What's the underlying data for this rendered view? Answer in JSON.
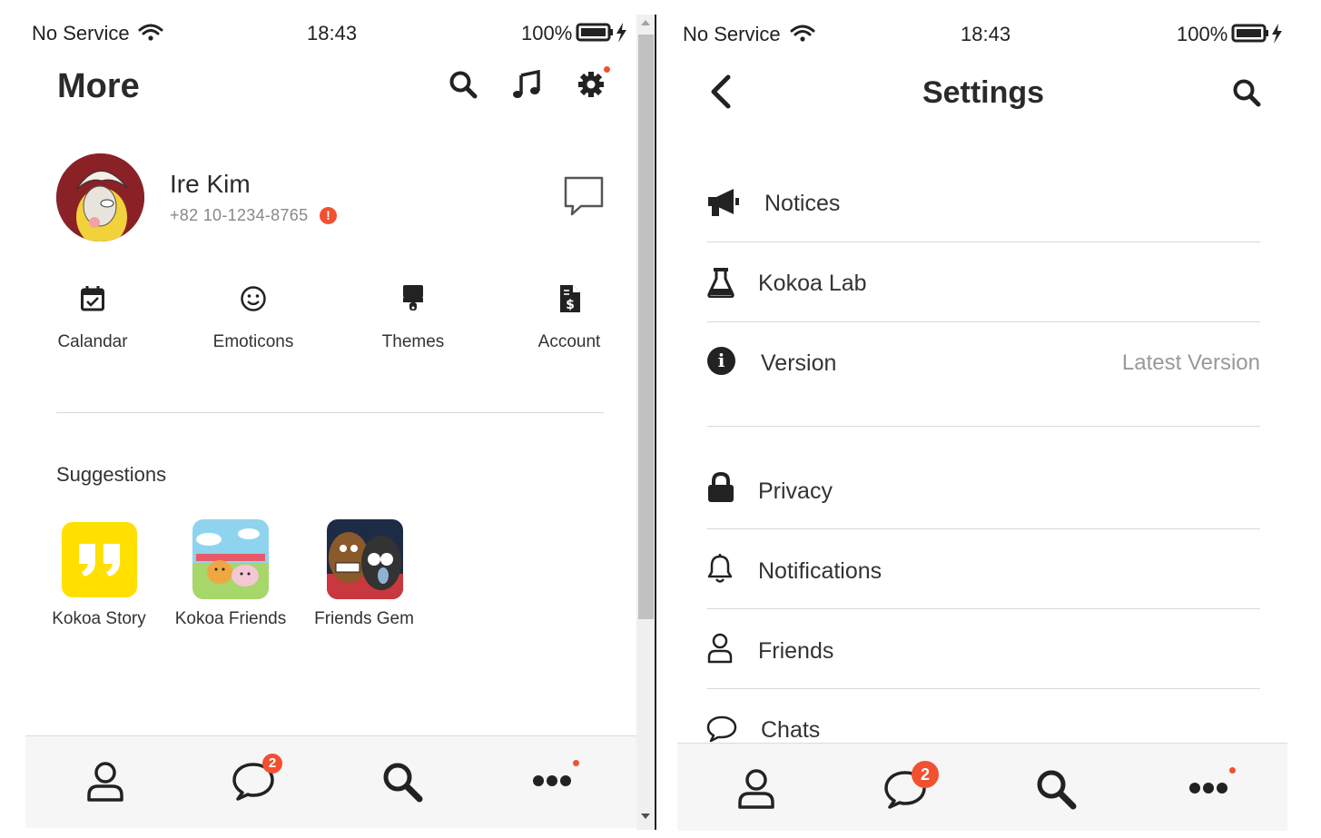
{
  "left": {
    "status": {
      "carrier": "No Service",
      "time": "18:43",
      "battery": "100%"
    },
    "header": {
      "title": "More"
    },
    "profile": {
      "name": "Ire Kim",
      "phone": "+82 10-1234-8765"
    },
    "quick_actions": [
      {
        "label": "Calandar",
        "icon": "calendar-check-icon"
      },
      {
        "label": "Emoticons",
        "icon": "smiley-icon"
      },
      {
        "label": "Themes",
        "icon": "paint-brush-icon"
      },
      {
        "label": "Account",
        "icon": "invoice-icon"
      }
    ],
    "suggestions": {
      "title": "Suggestions",
      "items": [
        {
          "label": "Kokoa Story"
        },
        {
          "label": "Kokoa Friends"
        },
        {
          "label": "Friends Gem"
        }
      ]
    },
    "tabbar": {
      "chat_badge": "2"
    }
  },
  "right": {
    "status": {
      "carrier": "No Service",
      "time": "18:43",
      "battery": "100%"
    },
    "header": {
      "title": "Settings"
    },
    "items": [
      {
        "label": "Notices",
        "icon": "megaphone-icon"
      },
      {
        "label": "Kokoa Lab",
        "icon": "flask-icon"
      },
      {
        "label": "Version",
        "icon": "info-circle-icon",
        "value": "Latest Version"
      },
      {
        "label": "Privacy",
        "icon": "lock-icon"
      },
      {
        "label": "Notifications",
        "icon": "bell-icon"
      },
      {
        "label": "Friends",
        "icon": "user-icon"
      },
      {
        "label": "Chats",
        "icon": "chat-bubble-icon"
      }
    ],
    "tabbar": {
      "chat_badge": "2"
    }
  },
  "colors": {
    "accent_red": "#f25030",
    "kakao_yellow": "#ffe000",
    "text_dark": "#222222"
  }
}
